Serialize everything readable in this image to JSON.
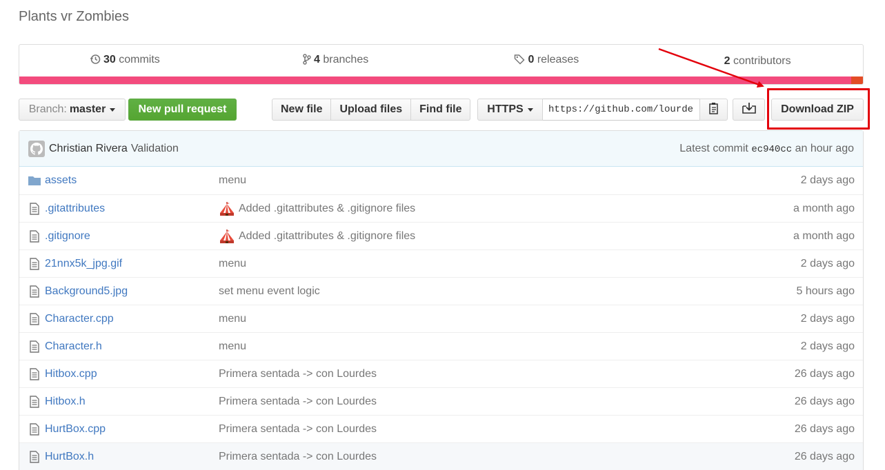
{
  "repo": {
    "description": "Plants vr Zombies"
  },
  "summary": {
    "commits": {
      "count": "30",
      "label": "commits"
    },
    "branches": {
      "count": "4",
      "label": "branches"
    },
    "releases": {
      "count": "0",
      "label": "releases"
    },
    "contributors": {
      "count": "2",
      "label": "contributors"
    }
  },
  "language_bar_colors": [
    "#f34b7d",
    "#e34c26"
  ],
  "toolbar": {
    "branch_label": "Branch:",
    "branch_name": "master",
    "new_pull_request": "New pull request",
    "new_file": "New file",
    "upload_files": "Upload files",
    "find_file": "Find file",
    "clone_protocol": "HTTPS",
    "clone_url": "https://github.com/lourdes",
    "download_zip": "Download ZIP"
  },
  "latest_commit": {
    "author": "Christian Rivera",
    "message": "Validation",
    "label": "Latest commit",
    "sha": "ec940cc",
    "age": "an hour ago"
  },
  "files": [
    {
      "type": "folder",
      "name": "assets",
      "message": "menu",
      "age": "2 days ago"
    },
    {
      "type": "file",
      "name": ".gitattributes",
      "message": "Added .gitattributes & .gitignore files",
      "emoji": true,
      "age": "a month ago"
    },
    {
      "type": "file",
      "name": ".gitignore",
      "message": "Added .gitattributes & .gitignore files",
      "emoji": true,
      "age": "a month ago"
    },
    {
      "type": "file",
      "name": "21nnx5k_jpg.gif",
      "message": "menu",
      "age": "2 days ago"
    },
    {
      "type": "file",
      "name": "Background5.jpg",
      "message": "set menu event logic",
      "age": "5 hours ago"
    },
    {
      "type": "file",
      "name": "Character.cpp",
      "message": "menu",
      "age": "2 days ago"
    },
    {
      "type": "file",
      "name": "Character.h",
      "message": "menu",
      "age": "2 days ago"
    },
    {
      "type": "file",
      "name": "Hitbox.cpp",
      "message": "Primera sentada -> con Lourdes",
      "age": "26 days ago"
    },
    {
      "type": "file",
      "name": "Hitbox.h",
      "message": "Primera sentada -> con Lourdes",
      "age": "26 days ago"
    },
    {
      "type": "file",
      "name": "HurtBox.cpp",
      "message": "Primera sentada -> con Lourdes",
      "age": "26 days ago"
    },
    {
      "type": "file",
      "name": "HurtBox.h",
      "message": "Primera sentada -> con Lourdes",
      "age": "26 days ago"
    }
  ]
}
